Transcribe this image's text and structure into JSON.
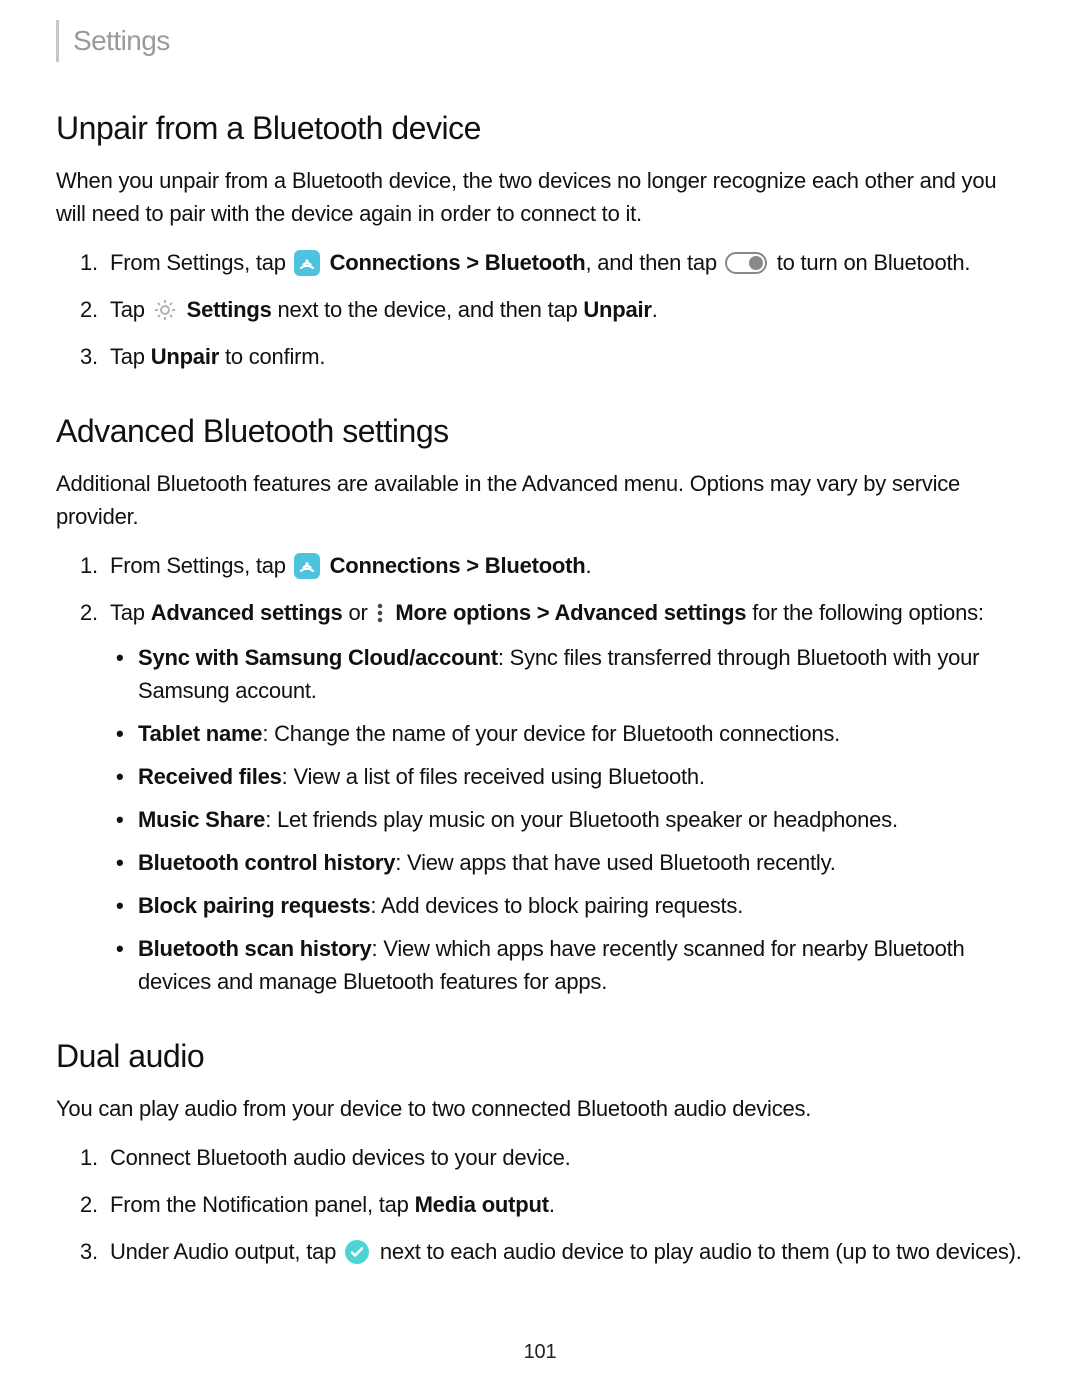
{
  "header": {
    "title": "Settings"
  },
  "section1": {
    "heading": "Unpair from a Bluetooth device",
    "intro": "When you unpair from a Bluetooth device, the two devices no longer recognize each other and you will need to pair with the device again in order to connect to it.",
    "step1": {
      "pre": "From Settings, tap ",
      "b1": "Connections > Bluetooth",
      "mid": ", and then tap ",
      "post": " to turn on Bluetooth."
    },
    "step2": {
      "pre": "Tap ",
      "b1": "Settings",
      "mid": " next to the device, and then tap ",
      "b2": "Unpair",
      "post": "."
    },
    "step3": {
      "pre": "Tap ",
      "b1": "Unpair",
      "post": " to confirm."
    }
  },
  "section2": {
    "heading": "Advanced Bluetooth settings",
    "intro": "Additional Bluetooth features are available in the Advanced menu. Options may vary by service provider.",
    "step1": {
      "pre": "From Settings, tap ",
      "b1": "Connections > Bluetooth",
      "post": "."
    },
    "step2": {
      "pre": "Tap ",
      "b1": "Advanced settings",
      "mid": " or ",
      "b2": "More options > Advanced settings",
      "post": " for the following options:"
    },
    "bullets": [
      {
        "b": "Sync with Samsung Cloud/account",
        "t": ": Sync files transferred through Bluetooth with your Samsung account."
      },
      {
        "b": "Tablet name",
        "t": ": Change the name of your device for Bluetooth connections."
      },
      {
        "b": "Received files",
        "t": ": View a list of files received using Bluetooth."
      },
      {
        "b": "Music Share",
        "t": ": Let friends play music on your Bluetooth speaker or headphones."
      },
      {
        "b": "Bluetooth control history",
        "t": ": View apps that have used Bluetooth recently."
      },
      {
        "b": "Block pairing requests",
        "t": ": Add devices to block pairing requests."
      },
      {
        "b": "Bluetooth scan history",
        "t": ": View which apps have recently scanned for nearby Bluetooth devices and manage Bluetooth features for apps."
      }
    ]
  },
  "section3": {
    "heading": "Dual audio",
    "intro": "You can play audio from your device to two connected Bluetooth audio devices.",
    "step1": "Connect Bluetooth audio devices to your device.",
    "step2": {
      "pre": "From the Notification panel, tap ",
      "b1": "Media output",
      "post": "."
    },
    "step3": {
      "pre": "Under Audio output, tap ",
      "post": " next to each audio device to play audio to them (up to two devices)."
    }
  },
  "pageNumber": "101",
  "icons": {
    "connections": {
      "bg": "#4ec3e0",
      "wave": "#ffffff"
    },
    "settings_gear": "#aeb4b7",
    "more_dots": "#4a4a4a",
    "check": {
      "bg": "#4cd3d3",
      "tick": "#ffffff"
    }
  }
}
